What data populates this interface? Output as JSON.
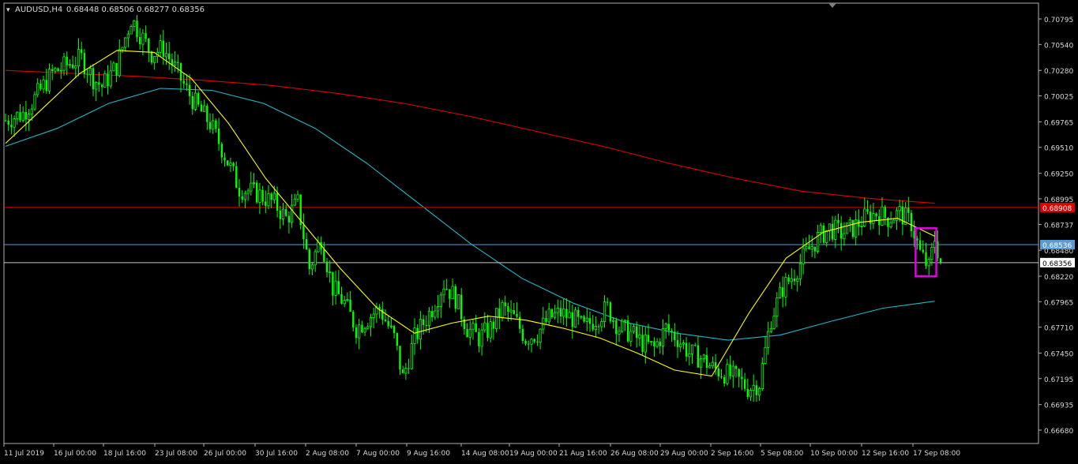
{
  "header": {
    "symbol_tf": "AUDUSD,H4",
    "ohlc_text": "0.68448 0.68506 0.68277 0.68356",
    "dropdown_glyph": "▾"
  },
  "colors": {
    "background": "#000000",
    "frame": "#b0b0b0",
    "bull": "#00ff00",
    "bear": "#00ff00",
    "ma_fast": "#ffff00",
    "ma_mid": "#1fb8c6",
    "ma_slow": "#e00000",
    "resistance_line": "#e00000",
    "level_mid": "#5b9bd5",
    "level_bid": "#c8c8c8",
    "highlight_box": "#e000e0",
    "text": "#d8d8d8"
  },
  "chart_data": {
    "type": "candlestick",
    "timeframe": "H4",
    "ylim": [
      0.6668,
      0.7089
    ],
    "y_ticks": [
      "0.70795",
      "0.70540",
      "0.70280",
      "0.70025",
      "0.69765",
      "0.69510",
      "0.69250",
      "0.68995",
      "0.68737",
      "0.68480",
      "0.68220",
      "0.67965",
      "0.67710",
      "0.67450",
      "0.67195",
      "0.66935",
      "0.66680"
    ],
    "x_ticks": [
      "11 Jul 2019",
      "16 Jul 00:00",
      "18 Jul 16:00",
      "23 Jul 08:00",
      "26 Jul 00:00",
      "30 Jul 16:00",
      "2 Aug 08:00",
      "7 Aug 00:00",
      "9 Aug 16:00",
      "14 Aug 08:00",
      "19 Aug 00:00",
      "21 Aug 16:00",
      "26 Aug 08:00",
      "29 Aug 00:00",
      "2 Sep 16:00",
      "5 Sep 08:00",
      "10 Sep 00:00",
      "12 Sep 16:00",
      "17 Sep 08:00"
    ],
    "price_path": [
      [
        0,
        0.6978
      ],
      [
        6,
        0.6985
      ],
      [
        10,
        0.7
      ],
      [
        16,
        0.7025
      ],
      [
        22,
        0.7035
      ],
      [
        26,
        0.704
      ],
      [
        30,
        0.702
      ],
      [
        33,
        0.7012
      ],
      [
        38,
        0.7032
      ],
      [
        43,
        0.708
      ],
      [
        46,
        0.7065
      ],
      [
        50,
        0.7045
      ],
      [
        54,
        0.705
      ],
      [
        58,
        0.703
      ],
      [
        62,
        0.7008
      ],
      [
        66,
        0.699
      ],
      [
        70,
        0.6975
      ],
      [
        74,
        0.695
      ],
      [
        80,
        0.691
      ],
      [
        86,
        0.6905
      ],
      [
        92,
        0.6895
      ],
      [
        96,
        0.688
      ],
      [
        100,
        0.6895
      ],
      [
        104,
        0.683
      ],
      [
        108,
        0.686
      ],
      [
        112,
        0.681
      ],
      [
        116,
        0.6795
      ],
      [
        120,
        0.677
      ],
      [
        124,
        0.678
      ],
      [
        128,
        0.679
      ],
      [
        133,
        0.676
      ],
      [
        136,
        0.672
      ],
      [
        140,
        0.676
      ],
      [
        146,
        0.679
      ],
      [
        150,
        0.6815
      ],
      [
        154,
        0.68
      ],
      [
        158,
        0.677
      ],
      [
        162,
        0.676
      ],
      [
        166,
        0.677
      ],
      [
        170,
        0.679
      ],
      [
        174,
        0.678
      ],
      [
        178,
        0.676
      ],
      [
        182,
        0.6765
      ],
      [
        186,
        0.678
      ],
      [
        190,
        0.6785
      ],
      [
        194,
        0.678
      ],
      [
        198,
        0.677
      ],
      [
        202,
        0.678
      ],
      [
        206,
        0.679
      ],
      [
        210,
        0.677
      ],
      [
        214,
        0.6765
      ],
      [
        218,
        0.6755
      ],
      [
        222,
        0.675
      ],
      [
        226,
        0.677
      ],
      [
        230,
        0.676
      ],
      [
        234,
        0.6745
      ],
      [
        238,
        0.674
      ],
      [
        242,
        0.673
      ],
      [
        246,
        0.6725
      ],
      [
        250,
        0.672
      ],
      [
        254,
        0.671
      ],
      [
        258,
        0.6715
      ],
      [
        262,
        0.678
      ],
      [
        266,
        0.681
      ],
      [
        270,
        0.6825
      ],
      [
        274,
        0.6845
      ],
      [
        278,
        0.686
      ],
      [
        282,
        0.687
      ],
      [
        286,
        0.6865
      ],
      [
        290,
        0.687
      ],
      [
        294,
        0.688
      ],
      [
        298,
        0.6885
      ],
      [
        302,
        0.688
      ],
      [
        306,
        0.6885
      ],
      [
        310,
        0.6875
      ],
      [
        313,
        0.6845
      ],
      [
        316,
        0.683
      ],
      [
        318,
        0.686
      ],
      [
        320,
        0.6836
      ]
    ],
    "ma_fast_values": [
      0.6955,
      0.699,
      0.7025,
      0.7048,
      0.7046,
      0.702,
      0.6975,
      0.692,
      0.6875,
      0.683,
      0.679,
      0.6765,
      0.6775,
      0.6782,
      0.6778,
      0.677,
      0.676,
      0.6745,
      0.6728,
      0.6722,
      0.6785,
      0.684,
      0.6866,
      0.6876,
      0.688,
      0.6862
    ],
    "ma_mid_values": [
      0.6952,
      0.697,
      0.6995,
      0.701,
      0.7008,
      0.6995,
      0.697,
      0.6935,
      0.6895,
      0.6855,
      0.682,
      0.6795,
      0.6776,
      0.6765,
      0.6758,
      0.6763,
      0.6777,
      0.679,
      0.6797
    ],
    "ma_slow_values": [
      0.7028,
      0.7025,
      0.7022,
      0.7018,
      0.7013,
      0.7005,
      0.6995,
      0.6982,
      0.6967,
      0.6952,
      0.6935,
      0.692,
      0.6907,
      0.69,
      0.6895
    ],
    "levels": [
      {
        "price": 0.68908,
        "label": "0.68908",
        "label_bg": "#e00000",
        "label_fg": "#ffffff"
      },
      {
        "price": 0.68536,
        "label": "0.68536",
        "label_bg": "#5b9bd5",
        "label_fg": "#ffffff"
      },
      {
        "price": 0.68356,
        "label": "0.68356",
        "label_bg": "#ffffff",
        "label_fg": "#000000"
      }
    ],
    "highlight_box": {
      "from_bar": 312,
      "to_bar": 318,
      "price_high": 0.687,
      "price_low": 0.6822
    },
    "grid": false
  }
}
